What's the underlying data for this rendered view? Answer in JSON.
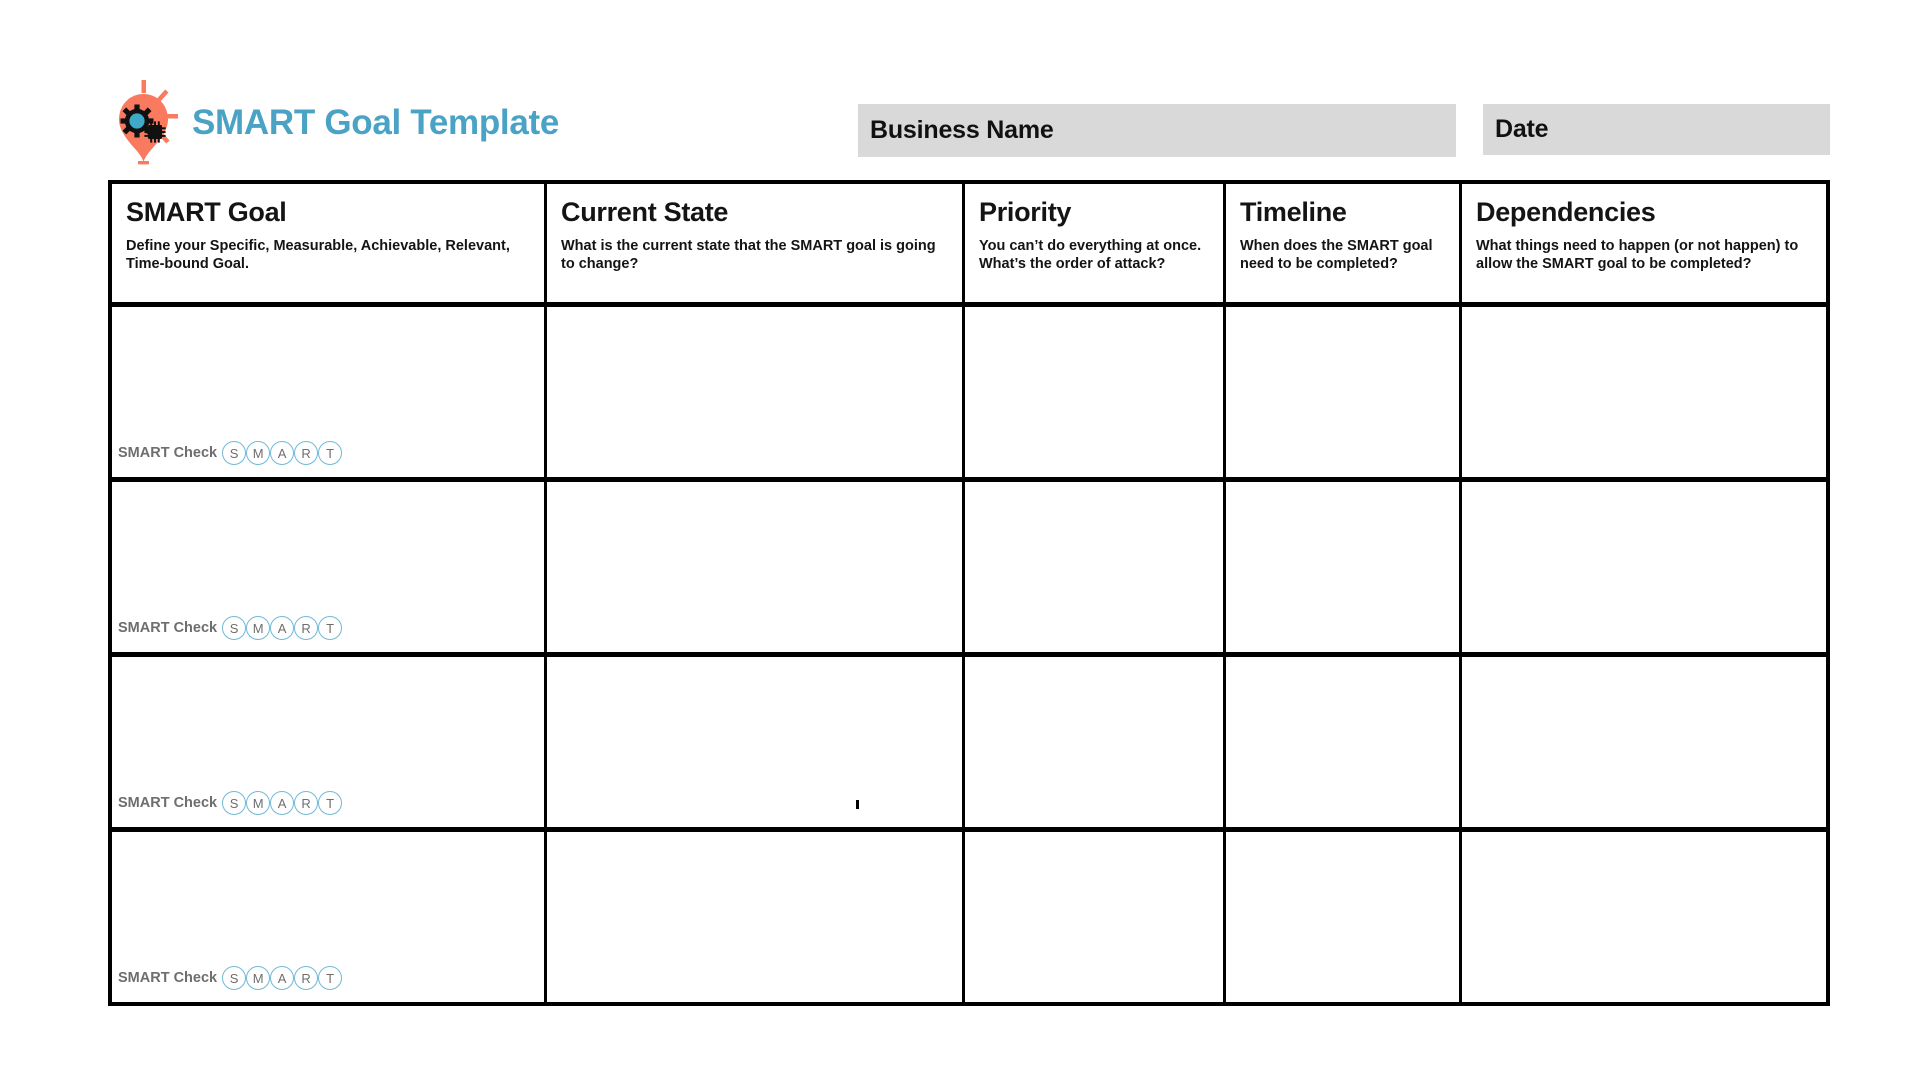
{
  "header": {
    "logo": {
      "icon_name": "lightbulb-gear-icon",
      "bulb_color": "#F97A5E",
      "gear_color": "#3FA9C9",
      "chip_color": "#111111"
    },
    "title": "SMART Goal Template",
    "title_color": "#4AA3C4",
    "fields": [
      {
        "name": "business-name",
        "label": "Business Name",
        "value": "",
        "box_color": "#D9D9D9"
      },
      {
        "name": "date",
        "label": "Date",
        "value": "",
        "box_color": "#D9D9D9"
      }
    ]
  },
  "table": {
    "columns": [
      {
        "title": "SMART Goal",
        "description": "Define your Specific, Measurable, Achievable, Relevant, Time-bound Goal."
      },
      {
        "title": "Current State",
        "description": "What is the current state that the SMART goal is going to change?"
      },
      {
        "title": "Priority",
        "description": "You can’t do everything at once. What’s the order of attack?"
      },
      {
        "title": "Timeline",
        "description": "When does the SMART goal need to be completed?"
      },
      {
        "title": "Dependencies",
        "description": "What things need to happen (or not happen) to allow the SMART goal to be completed?"
      }
    ],
    "smart_check": {
      "label": "SMART Check",
      "letters": [
        "S",
        "M",
        "A",
        "R",
        "T"
      ],
      "circle_color": "#6FB9D6",
      "letter_color": "#6E6E6E"
    },
    "rows": [
      {
        "smart_goal": "",
        "current_state": "",
        "priority": "",
        "timeline": "",
        "dependencies": ""
      },
      {
        "smart_goal": "",
        "current_state": "",
        "priority": "",
        "timeline": "",
        "dependencies": ""
      },
      {
        "smart_goal": "",
        "current_state": "",
        "priority": "",
        "timeline": "",
        "dependencies": ""
      },
      {
        "smart_goal": "",
        "current_state": "",
        "priority": "",
        "timeline": "",
        "dependencies": ""
      }
    ]
  }
}
